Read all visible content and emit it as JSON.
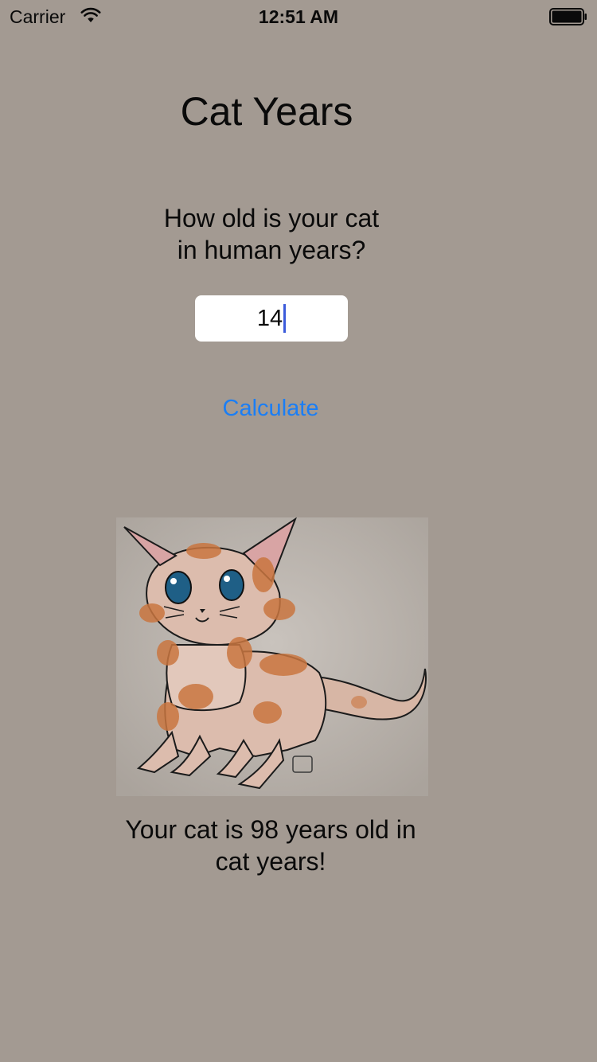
{
  "status_bar": {
    "carrier": "Carrier",
    "time": "12:51 AM",
    "wifi_icon": "wifi-icon",
    "battery_icon": "battery-full-icon"
  },
  "title": "Cat Years",
  "question": "How old is your cat\nin human years?",
  "age_input": {
    "value": "14",
    "caret_color": "#3b5bdb"
  },
  "calculate_label": "Calculate",
  "cat_image": "cat-illustration",
  "result": "Your cat is 98 years old in\ncat years!",
  "colors": {
    "background": "#a39a92",
    "accent": "#1a7ef5",
    "input_background": "#ffffff"
  }
}
